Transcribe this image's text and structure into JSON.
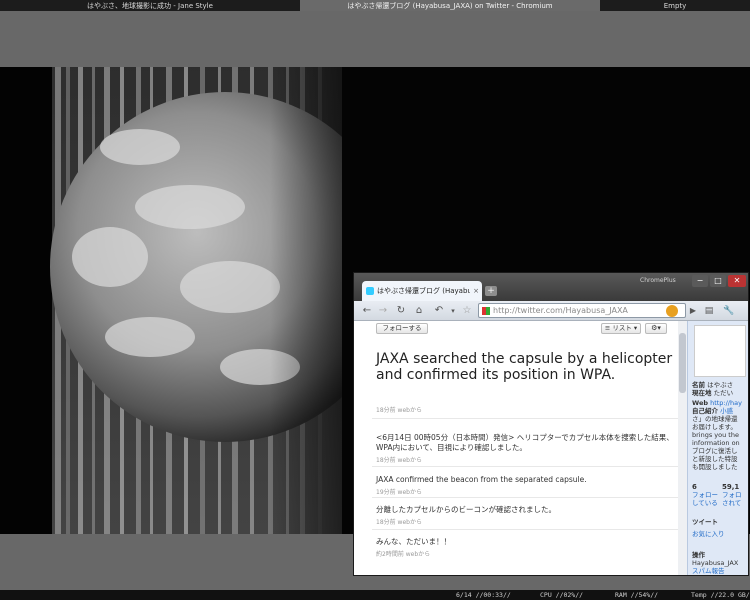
{
  "taskbar": {
    "items": [
      "はやぶさ、地球撮影に成功 - Jane Style",
      "はやぶさ帰還ブログ (Hayabusa_JAXA) on Twitter - Chromium",
      "Empty"
    ]
  },
  "status": {
    "datetime": "6/14 //00:33//",
    "cpu": "CPU //02%//",
    "ram": "RAM //54%//",
    "temp": "Temp //22.0 GB//"
  },
  "browser": {
    "brand": "ChromePlus",
    "tab_title": "はやぶさ帰還ブログ (Hayabu",
    "tab_close": "×",
    "new_tab": "+",
    "url": "http://twitter.com/Hayabusa_JAXA",
    "window_controls": {
      "minimize": "−",
      "maximize": "□",
      "close": "✕"
    }
  },
  "twitter": {
    "follow_button": "フォローする",
    "list_button": "リスト",
    "main_tweet": {
      "text": "JAXA searched the capsule by a helicopter and confirmed its position in WPA.",
      "meta": "18分前 webから"
    },
    "tweets": [
      {
        "text": "<6月14日 00時05分（日本時間）発信> ヘリコプターでカプセル本体を捜索した結果、WPA内において、目視により確認しました。",
        "meta": "18分前 webから"
      },
      {
        "text": "JAXA confirmed the beacon from the separated capsule.",
        "meta": "19分前 webから"
      },
      {
        "text": "分離したカプセルからのビーコンが確認されました。",
        "meta": "18分前 webから"
      },
      {
        "text": "みんな、ただいま！！",
        "meta": "約2時間前 webから"
      }
    ],
    "sidebar": {
      "name_label": "名前",
      "name_value": "はやぶさ",
      "location_label": "現在地",
      "location_value": "ただい",
      "web_label": "Web",
      "web_value": "http://hay",
      "bio_label": "自己紹介",
      "bio_value": [
        "小惑",
        "さ」の地球帰還",
        "お届けします。",
        "brings you the",
        "information on",
        "ブログに復活し",
        "と新設した特設",
        "も開設しました"
      ],
      "following_count": "6",
      "followers_count": "59,1",
      "following_label": "フォロー",
      "following_label2": "している",
      "followers_label": "フォロ",
      "followers_label2": "されて",
      "tweets_label": "ツイート",
      "favorites_label": "お気に入り",
      "actions_label": "操作",
      "block_line1": "Hayabusa_JAX",
      "block_line2": "スパム報告"
    }
  }
}
